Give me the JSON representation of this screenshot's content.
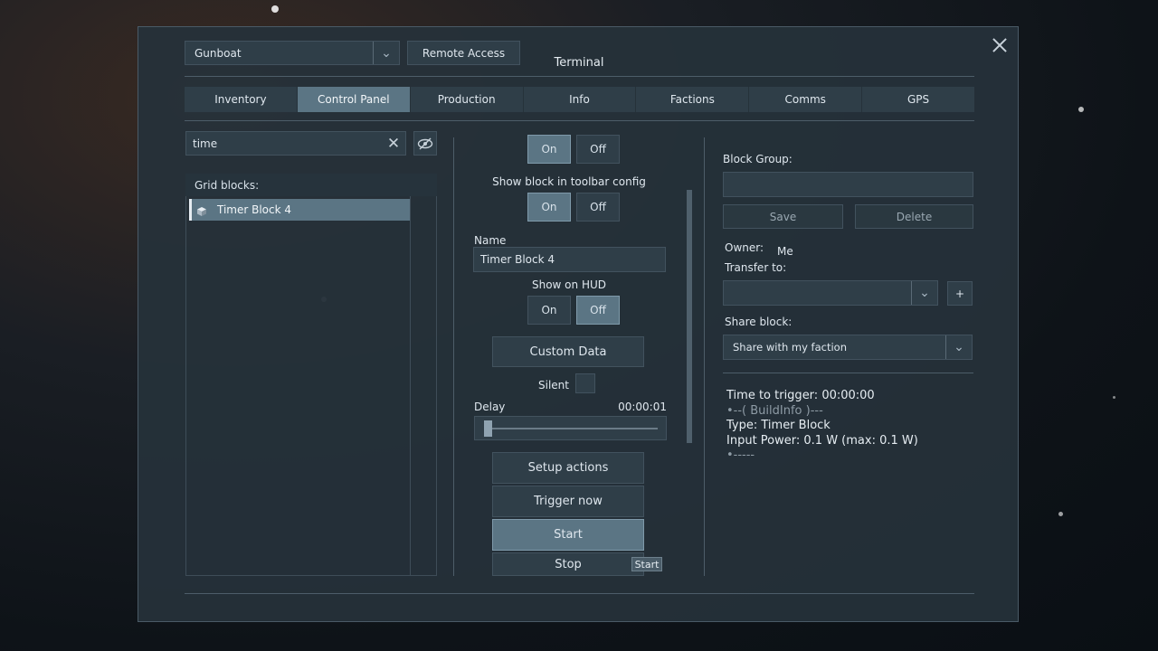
{
  "window": {
    "title": "Terminal",
    "grid_selector": "Gunboat",
    "remote_access_label": "Remote Access"
  },
  "tabs": [
    {
      "label": "Inventory",
      "active": false
    },
    {
      "label": "Control Panel",
      "active": true
    },
    {
      "label": "Production",
      "active": false
    },
    {
      "label": "Info",
      "active": false
    },
    {
      "label": "Factions",
      "active": false
    },
    {
      "label": "Comms",
      "active": false
    },
    {
      "label": "GPS",
      "active": false
    }
  ],
  "left": {
    "search_value": "time",
    "grid_blocks_label": "Grid blocks:",
    "items": [
      {
        "label": "Timer Block 4",
        "selected": true
      }
    ]
  },
  "middle": {
    "toggle1": {
      "on": "On",
      "off": "Off",
      "selected": "On"
    },
    "show_toolbar_label": "Show block in toolbar config",
    "toggle2": {
      "on": "On",
      "off": "Off",
      "selected": "On"
    },
    "name_label": "Name",
    "name_value": "Timer Block 4",
    "show_hud_label": "Show on HUD",
    "toggle3": {
      "on": "On",
      "off": "Off",
      "selected": "Off"
    },
    "custom_data_label": "Custom Data",
    "silent_label": "Silent",
    "delay_label": "Delay",
    "delay_value": "00:00:01",
    "setup_actions_label": "Setup actions",
    "trigger_now_label": "Trigger now",
    "start_label": "Start",
    "stop_label": "Stop",
    "tooltip": "Start"
  },
  "right": {
    "block_group_label": "Block Group:",
    "block_group_value": "",
    "save_label": "Save",
    "delete_label": "Delete",
    "owner_label": "Owner:",
    "owner_value": "Me",
    "transfer_label": "Transfer to:",
    "transfer_value": "",
    "add_label": "+",
    "share_label": "Share block:",
    "share_value": "Share with my faction",
    "info_lines": [
      "Time to trigger: 00:00:00",
      "•--( BuildInfo )---",
      "Type: Timer Block",
      "Input Power: 0.1 W (max: 0.1 W)",
      "•-----"
    ]
  },
  "icons": {
    "close": "close-icon",
    "dropdown": "chevron-down-icon",
    "clear": "clear-icon",
    "hide": "eye-slash-icon",
    "block": "cube-icon"
  }
}
